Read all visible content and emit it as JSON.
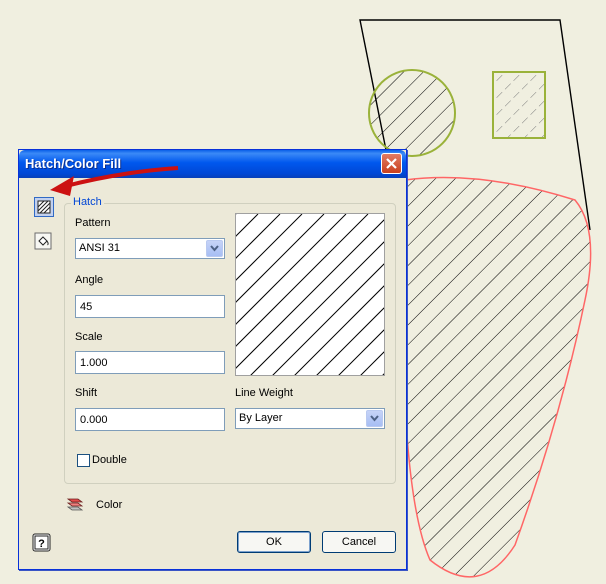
{
  "dialog": {
    "title": "Hatch/Color Fill",
    "hatch_group_label": "Hatch",
    "pattern": {
      "label": "Pattern",
      "value": "ANSI 31"
    },
    "angle": {
      "label": "Angle",
      "value": "45"
    },
    "scale": {
      "label": "Scale",
      "value": "1.000"
    },
    "shift": {
      "label": "Shift",
      "value": "0.000"
    },
    "line_weight": {
      "label": "Line Weight",
      "value": "By Layer"
    },
    "double_label": "Double",
    "double_checked": false,
    "color_label": "Color",
    "ok_label": "OK",
    "cancel_label": "Cancel"
  },
  "icons": {
    "close": "close-icon",
    "hatch_mode": "hatch-icon",
    "color_fill_mode": "paint-bucket-icon",
    "color": "color-swatch-icon",
    "help": "help-icon",
    "arrow": "red-annotation-arrow"
  },
  "colors": {
    "title_bar": "#0054e3",
    "sketch_line": "#000000",
    "circle_outline": "#9ab23a",
    "rect_outline": "#9ab23a",
    "curve_outline": "#ff6666",
    "annotation_arrow": "#cc1111"
  }
}
